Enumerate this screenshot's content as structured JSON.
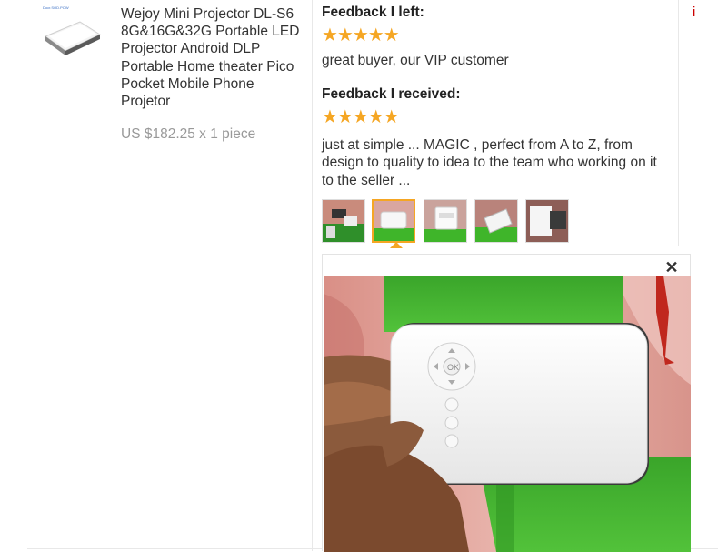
{
  "product": {
    "title": "Wejoy Mini Projector DL-S6 8G&16G&32G Portable LED Projector Android DLP Portable Home theater Pico Pocket Mobile Phone Projetor",
    "price": "US $182.25 x 1 piece",
    "thumb_logo_text": "Docr.SOD.POW"
  },
  "feedback_left": {
    "heading": "Feedback I left:",
    "stars": "★★★★★",
    "text": "great buyer, our VIP customer"
  },
  "feedback_received": {
    "heading": "Feedback I received:",
    "stars": "★★★★★",
    "text": "just at simple ... MAGIC , perfect from A to Z, from design to quality to idea to the team who working on it to the seller ..."
  },
  "photos": {
    "count": 5,
    "active_index": 1,
    "close_label": "✕"
  },
  "corner_mark": "i",
  "colors": {
    "star": "#f5a623",
    "active_border": "#f5a623",
    "box_green": "#3fb52a"
  }
}
